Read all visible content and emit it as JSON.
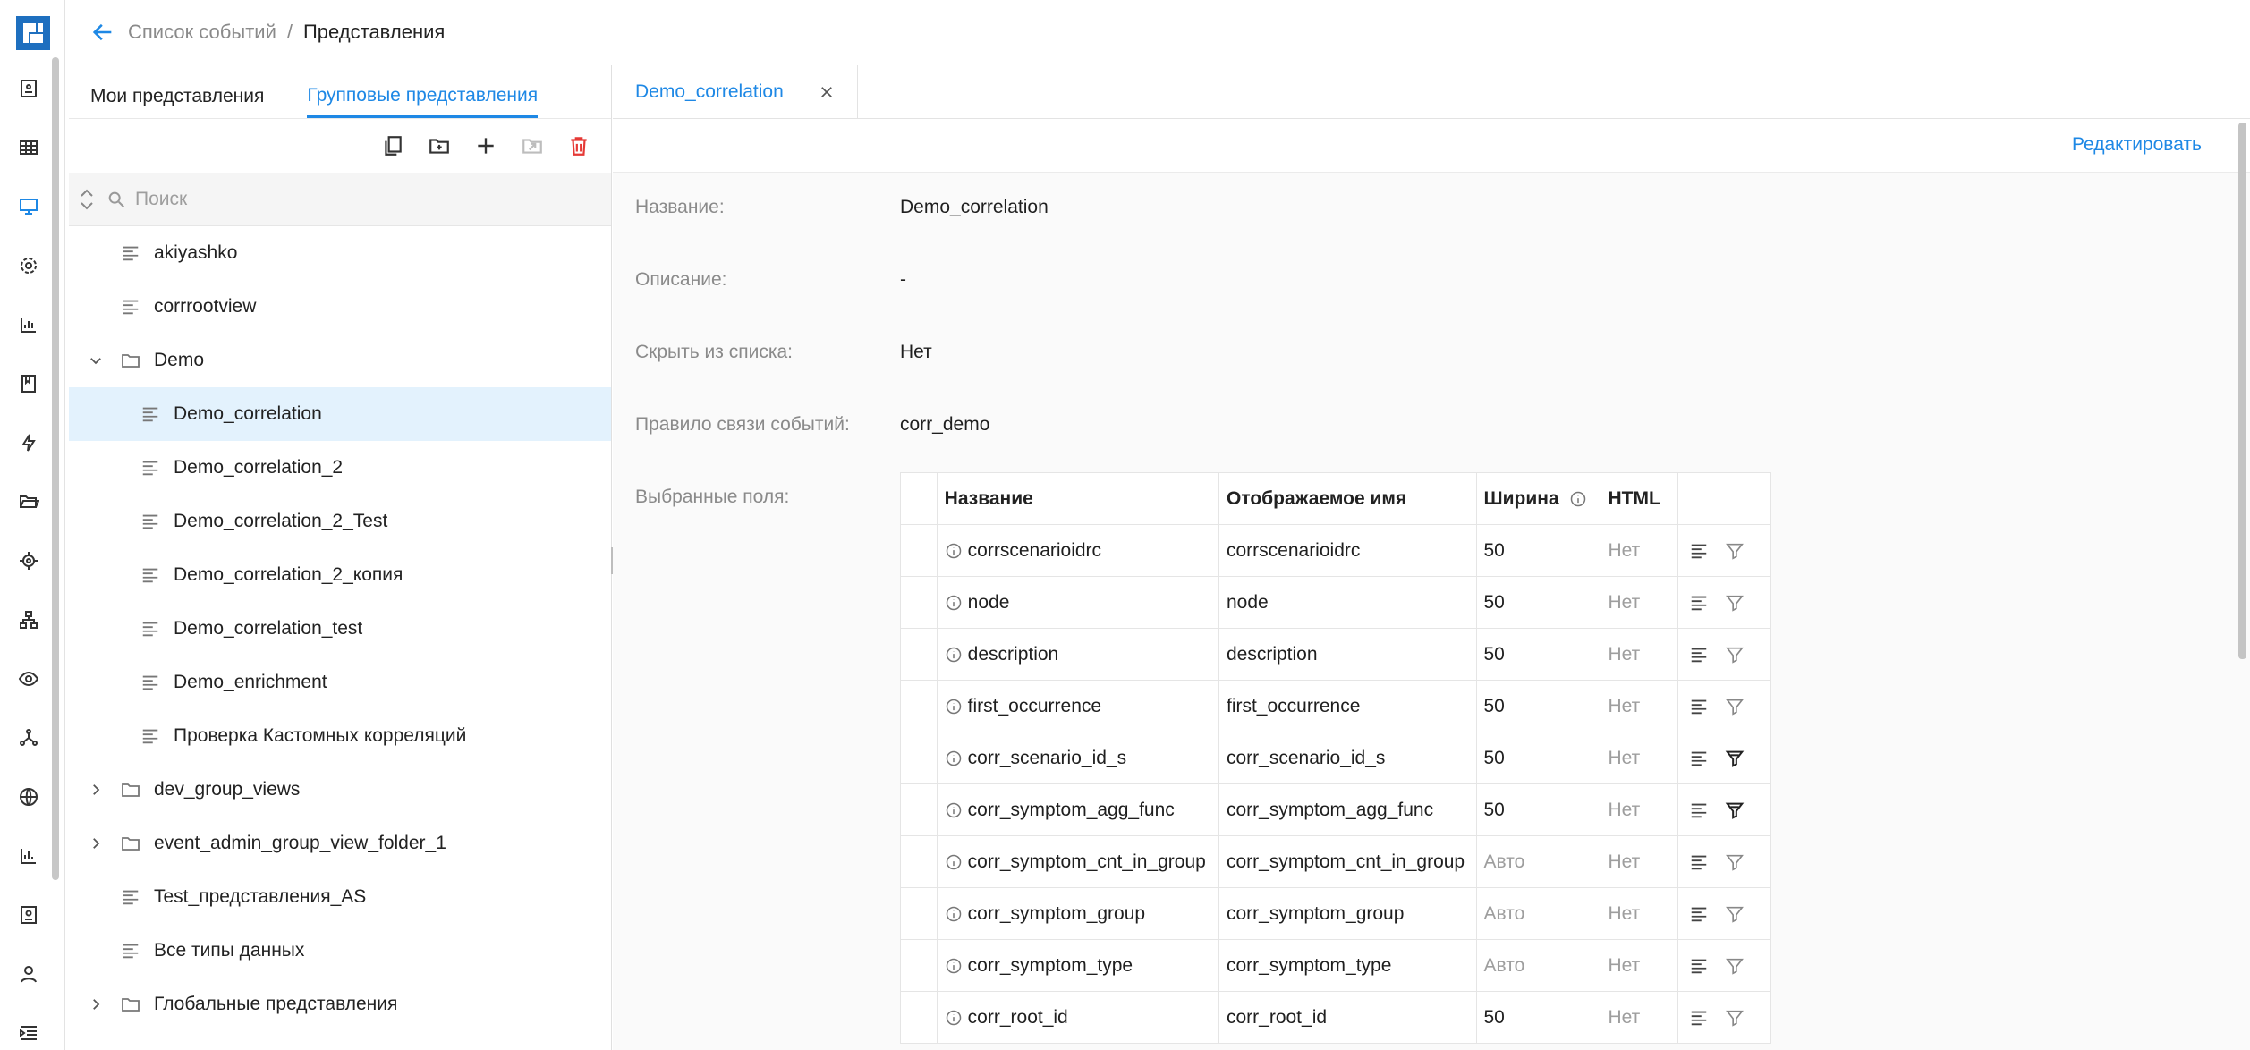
{
  "breadcrumb": {
    "parent": "Список событий",
    "separator": "/",
    "current": "Представления"
  },
  "left_panel": {
    "tabs": [
      {
        "label": "Мои представления"
      },
      {
        "label": "Групповые представления"
      }
    ],
    "search": {
      "placeholder": "Поиск"
    },
    "tree": [
      {
        "label": "akiyashko",
        "type": "view"
      },
      {
        "label": "corrrootview",
        "type": "view"
      },
      {
        "label": "Demo",
        "type": "folder",
        "expanded": true
      },
      {
        "label": "Demo_correlation",
        "type": "view",
        "selected": true
      },
      {
        "label": "Demo_correlation_2",
        "type": "view"
      },
      {
        "label": "Demo_correlation_2_Test",
        "type": "view"
      },
      {
        "label": "Demo_correlation_2_копия",
        "type": "view"
      },
      {
        "label": "Demo_correlation_test",
        "type": "view"
      },
      {
        "label": "Demo_enrichment",
        "type": "view"
      },
      {
        "label": "Проверка Кастомных корреляций",
        "type": "view"
      },
      {
        "label": "dev_group_views",
        "type": "folder",
        "expanded": false
      },
      {
        "label": "event_admin_group_view_folder_1",
        "type": "folder",
        "expanded": false
      },
      {
        "label": "Test_представления_AS",
        "type": "view"
      },
      {
        "label": "Все типы данных",
        "type": "view"
      },
      {
        "label": "Глобальные представления",
        "type": "folder",
        "expanded": false
      }
    ]
  },
  "right_panel": {
    "tab_label": "Demo_correlation",
    "edit_label": "Редактировать",
    "props": {
      "name_label": "Название:",
      "name_value": "Demo_correlation",
      "desc_label": "Описание:",
      "desc_value": "-",
      "hide_label": "Скрыть из списка:",
      "hide_value": "Нет",
      "rule_label": "Правило связи событий:",
      "rule_value": "corr_demo",
      "fields_label": "Выбранные поля:"
    },
    "table": {
      "headers": {
        "name": "Название",
        "display": "Отображаемое имя",
        "width": "Ширина",
        "html": "HTML"
      },
      "rows": [
        {
          "name": "corrscenarioidrc",
          "display": "corrscenarioidrc",
          "width": "50",
          "html": "Нет",
          "filter_active": false
        },
        {
          "name": "node",
          "display": "node",
          "width": "50",
          "html": "Нет",
          "filter_active": false
        },
        {
          "name": "description",
          "display": "description",
          "width": "50",
          "html": "Нет",
          "filter_active": false
        },
        {
          "name": "first_occurrence",
          "display": "first_occurrence",
          "width": "50",
          "html": "Нет",
          "filter_active": false
        },
        {
          "name": "corr_scenario_id_s",
          "display": "corr_scenario_id_s",
          "width": "50",
          "html": "Нет",
          "filter_active": true
        },
        {
          "name": "corr_symptom_agg_func",
          "display": "corr_symptom_agg_func",
          "width": "50",
          "html": "Нет",
          "filter_active": true
        },
        {
          "name": "corr_symptom_cnt_in_group",
          "display": "corr_symptom_cnt_in_group",
          "width": "Авто",
          "html": "Нет",
          "filter_active": false
        },
        {
          "name": "corr_symptom_group",
          "display": "corr_symptom_group",
          "width": "Авто",
          "html": "Нет",
          "filter_active": false
        },
        {
          "name": "corr_symptom_type",
          "display": "corr_symptom_type",
          "width": "Авто",
          "html": "Нет",
          "filter_active": false
        },
        {
          "name": "corr_root_id",
          "display": "corr_root_id",
          "width": "50",
          "html": "Нет",
          "filter_active": false
        }
      ]
    }
  },
  "colors": {
    "accent": "#1e88e5",
    "selected_bg": "#e3f2fd",
    "danger": "#e53935",
    "muted": "#9e9e9e"
  }
}
